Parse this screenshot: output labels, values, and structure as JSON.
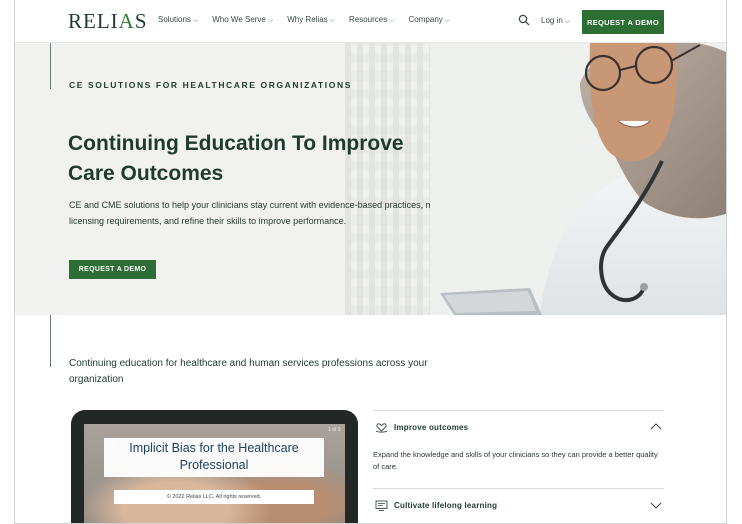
{
  "brand": {
    "logo_text_left": "RELI",
    "logo_text_right": "S",
    "logo_mark": "A"
  },
  "nav": {
    "items": [
      {
        "label": "Solutions"
      },
      {
        "label": "Who We Serve"
      },
      {
        "label": "Why Relias"
      },
      {
        "label": "Resources"
      },
      {
        "label": "Company"
      }
    ],
    "login_label": "Log in",
    "cta_label": "REQUEST A DEMO",
    "search_icon": "search-icon"
  },
  "hero": {
    "eyebrow": "CE SOLUTIONS FOR HEALTHCARE ORGANIZATIONS",
    "title": "Continuing Education To Improve Care Outcomes",
    "description": "CE and CME solutions to help your clinicians stay current with evidence-based practices, meet licensing requirements, and refine their skills to improve performance.",
    "cta_label": "REQUEST A DEMO"
  },
  "section": {
    "intro": "Continuing education for healthcare and human services professions across your organization",
    "video": {
      "title": "Implicit Bias for the Healthcare Professional",
      "copyright": "© 2022 Relias LLC. All rights reserved.",
      "slide_counter": "1 of 9",
      "menu_icon": "menu-icon"
    },
    "accordion": [
      {
        "title": "Improve outcomes",
        "body": "Expand the knowledge and skills of your clinicians so they can provide a better quality of care.",
        "expanded": true,
        "icon": "heart-hands-icon"
      },
      {
        "title": "Cultivate lifelong learning",
        "expanded": false,
        "icon": "screen-learning-icon"
      }
    ]
  },
  "colors": {
    "brand_green": "#2d6e35",
    "text_dark": "#1f3a2f",
    "hero_bg": "#f1f2f0"
  }
}
